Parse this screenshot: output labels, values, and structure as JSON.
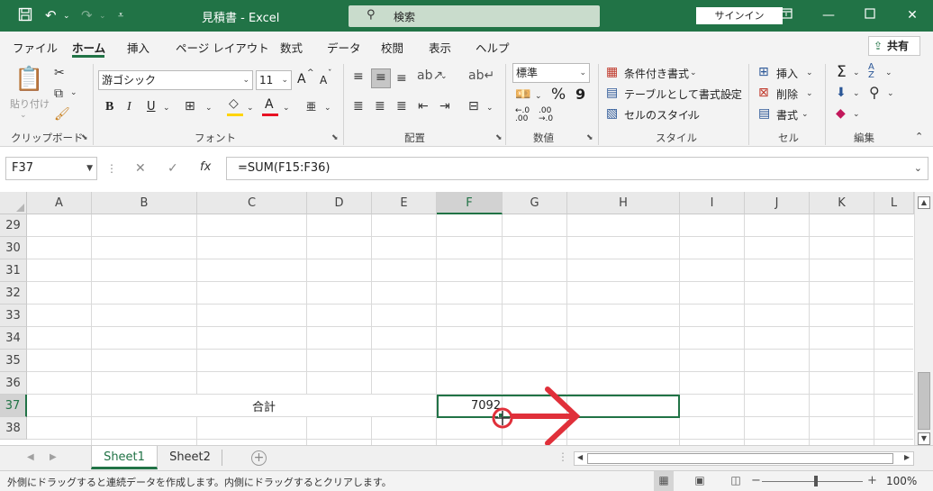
{
  "titlebar": {
    "title": "見積書  -  Excel",
    "search_label": "検索",
    "signin": "サインイン",
    "icons": {
      "save": "save-icon",
      "undo": "undo-icon",
      "redo": "redo-icon"
    }
  },
  "ribbon_tabs": [
    "ファイル",
    "ホーム",
    "挿入",
    "ページ レイアウト",
    "数式",
    "データ",
    "校閲",
    "表示",
    "ヘルプ"
  ],
  "active_tab": "ホーム",
  "share_label": "共有",
  "ribbon": {
    "clipboard": {
      "paste": "貼り付け",
      "group": "クリップボード"
    },
    "font": {
      "name": "游ゴシック",
      "size": "11",
      "grow": "A",
      "shrink": "A",
      "bold": "B",
      "italic": "I",
      "underline": "U",
      "color_a": "A",
      "phonetic": "亜",
      "group": "フォント"
    },
    "alignment": {
      "group": "配置"
    },
    "number": {
      "format": "標準",
      "percent": "%",
      "comma": "9",
      "inc_decimal": "←.0 .00",
      "dec_decimal": ".00 →.0",
      "group": "数値"
    },
    "styles": {
      "conditional": "条件付き書式",
      "as_table": "テーブルとして書式設定",
      "cell_styles": "セルのスタイル",
      "group": "スタイル"
    },
    "cells": {
      "insert": "挿入",
      "delete": "削除",
      "format": "書式",
      "group": "セル"
    },
    "editing": {
      "sum": "Σ",
      "sort": "A Z",
      "group": "編集"
    },
    "colors": {
      "brand": "#217346",
      "highlight": "#FFD400",
      "font_color": "#E81123"
    }
  },
  "formula_bar": {
    "name_box": "F37",
    "formula": "=SUM(F15:F36)",
    "cancel": "✕",
    "enter": "✓",
    "fx": "fx"
  },
  "grid": {
    "columns": [
      "A",
      "B",
      "C",
      "D",
      "E",
      "F",
      "G",
      "H",
      "I",
      "J",
      "K",
      "L"
    ],
    "rows": [
      "29",
      "30",
      "31",
      "32",
      "33",
      "34",
      "35",
      "36",
      "37",
      "38"
    ],
    "selected_column": "F",
    "selected_row": "37",
    "cells": {
      "C37": "合計",
      "F37": "7092"
    },
    "annotation": "red-arrow-right"
  },
  "sheets": [
    "Sheet1",
    "Sheet2"
  ],
  "active_sheet": "Sheet1",
  "status": {
    "message": "外側にドラッグすると連続データを作成します。内側にドラッグするとクリアします。",
    "zoom": "100%",
    "zoom_minus": "−",
    "zoom_plus": "+"
  }
}
